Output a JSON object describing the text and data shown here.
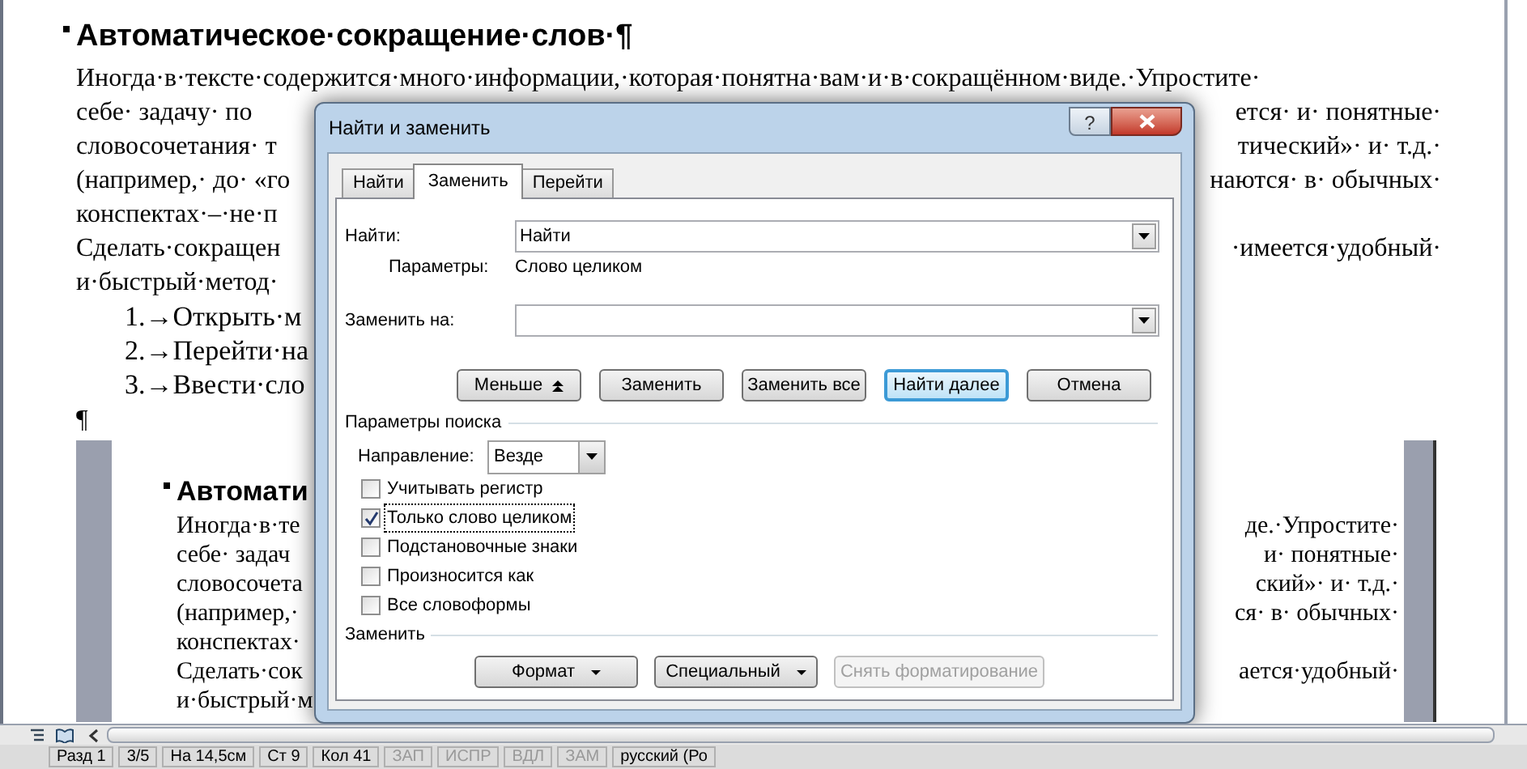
{
  "document": {
    "heading": "Автоматическое·сокращение·слов·¶",
    "lines": [
      {
        "left": "Иногда·в·тексте·содержится·много·информации,·которая·понятна·вам·и·в·сокращённом·виде.·Упростите·"
      },
      {
        "left": "себе· задачу· по",
        "right": "ется· и· понятные·"
      },
      {
        "left": "словосочетания· т",
        "right": "тический»· и· т.д.·"
      },
      {
        "left": "(например,· до· «го",
        "right": "наются· в· обычных·"
      },
      {
        "left": "конспектах·–·не·п"
      },
      {
        "left": "Сделать·сокращен",
        "right": "·имеется·удобный·"
      },
      {
        "left": "и·быстрый·метод·"
      }
    ],
    "list": [
      "1.→Открыть·м",
      "2.→Перейти·на",
      "3.→Ввести·сло"
    ],
    "pilcrow": "¶"
  },
  "embedded_page": {
    "heading": "Автомати",
    "lines": [
      {
        "left": "Иногда·в·те",
        "right": "де.·Упростите·"
      },
      {
        "left": "себе· задач",
        "right": "и· понятные·"
      },
      {
        "left": "словосочета",
        "right": "ский»· и· т.д.·"
      },
      {
        "left": "(например,·",
        "right": "ся· в· обычных·"
      },
      {
        "left": "конспектах·"
      },
      {
        "left": "Сделать·сок",
        "right": "ается·удобный·"
      },
      {
        "left": "и·быстрый·м"
      }
    ]
  },
  "dialog": {
    "title": "Найти и заменить",
    "help": "?",
    "tabs": [
      {
        "label": "Найти",
        "selected": false
      },
      {
        "label": "Заменить",
        "selected": true
      },
      {
        "label": "Перейти",
        "selected": false
      }
    ],
    "find": {
      "label": "Найти:",
      "value": "Найти"
    },
    "options": {
      "label": "Параметры:",
      "value": "Слово целиком"
    },
    "replace": {
      "label": "Заменить на:"
    },
    "buttons": [
      {
        "label": "Меньше",
        "kind": "less",
        "default": false
      },
      {
        "label": "Заменить",
        "kind": "action",
        "default": false
      },
      {
        "label": "Заменить все",
        "kind": "action",
        "default": false
      },
      {
        "label": "Найти далее",
        "kind": "action",
        "default": true
      },
      {
        "label": "Отмена",
        "kind": "action",
        "default": false
      }
    ],
    "search_options": {
      "title": "Параметры поиска",
      "direction": {
        "label": "Направление:",
        "value": "Везде"
      },
      "checkboxes": [
        {
          "label": "Учитывать регистр",
          "checked": false,
          "focused": false
        },
        {
          "label": "Только слово целиком",
          "checked": true,
          "focused": true
        },
        {
          "label": "Подстановочные знаки",
          "checked": false,
          "focused": false
        },
        {
          "label": "Произносится как",
          "checked": false,
          "focused": false
        },
        {
          "label": "Все словоформы",
          "checked": false,
          "focused": false
        }
      ]
    },
    "replace_section": {
      "title": "Заменить",
      "buttons": [
        {
          "label": "Формат",
          "kind": "menu",
          "disabled": false
        },
        {
          "label": "Специальный",
          "kind": "menu",
          "disabled": false
        },
        {
          "label": "Снять форматирование",
          "kind": "action",
          "disabled": true
        }
      ]
    }
  },
  "status_bar": [
    "Разд 1",
    "3/5",
    "На 14,5см",
    "Ст 9",
    "Кол 41",
    "ЗАП",
    "ИСПР",
    "ВДЛ",
    "ЗАМ",
    "русский (Ро"
  ]
}
